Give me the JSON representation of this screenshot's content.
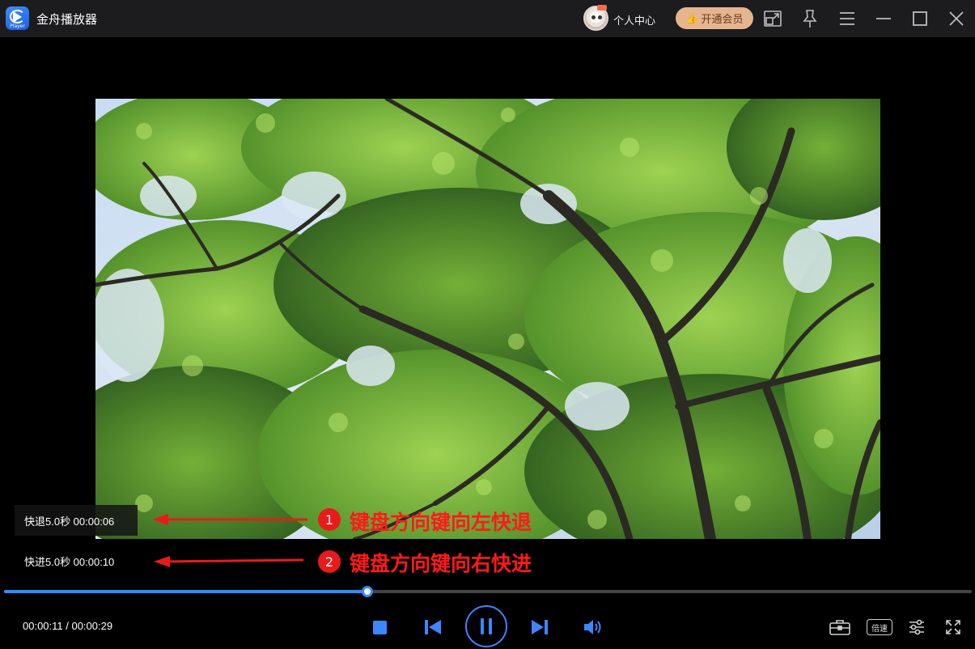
{
  "app": {
    "title": "金舟播放器",
    "logo_sub": "Player"
  },
  "header": {
    "user_center": "个人中心",
    "vip_button": "开通会员"
  },
  "overlay": {
    "rewind_text": "快退5.0秒 00:00:06",
    "forward_text": "快进5.0秒 00:00:10",
    "callouts": [
      {
        "number": "1",
        "text": "键盘方向键向左快退"
      },
      {
        "number": "2",
        "text": "键盘方向键向右快进"
      }
    ]
  },
  "playback": {
    "time_display": "00:00:11 / 00:00:29",
    "progress": 0.375,
    "speed_label": "倍速"
  },
  "colors": {
    "accent": "#3c86ff",
    "vip_bg": "#e6b48d",
    "callout_red": "#ff1a1a",
    "titlebar_bg": "#1c1c1f"
  },
  "icons": [
    "stop-icon",
    "prev-icon",
    "pause-icon",
    "next-icon",
    "volume-icon",
    "toolbox-icon",
    "settings-sliders-icon",
    "fullscreen-icon",
    "mini-window-icon",
    "pin-icon",
    "menu-icon",
    "minimize-icon",
    "maximize-icon",
    "close-icon"
  ]
}
